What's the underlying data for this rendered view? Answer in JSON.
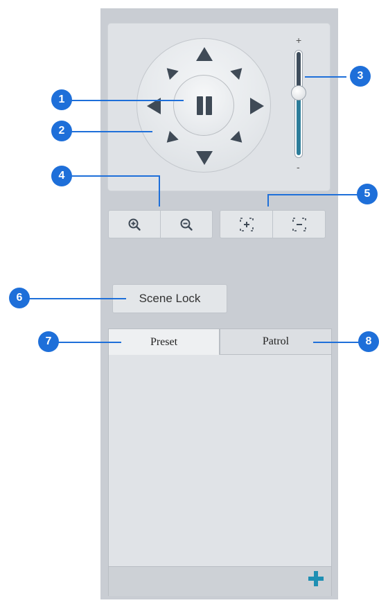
{
  "ptz": {
    "speed_plus": "+",
    "speed_minus": "-",
    "speed_level_fraction": 0.4
  },
  "buttons": {
    "scene_lock": "Scene Lock"
  },
  "tabs": [
    {
      "label": "Preset",
      "active": true
    },
    {
      "label": "Patrol",
      "active": false
    }
  ],
  "callouts": [
    "1",
    "2",
    "3",
    "4",
    "5",
    "6",
    "7",
    "8"
  ],
  "icons": [
    "zoom-in-icon",
    "zoom-out-icon",
    "focus-near-icon",
    "focus-far-icon",
    "pause-icon",
    "add-icon"
  ],
  "colors": {
    "callout": "#1e6fd9",
    "add": "#1f8fb3",
    "slider": "#2d7d9a"
  }
}
